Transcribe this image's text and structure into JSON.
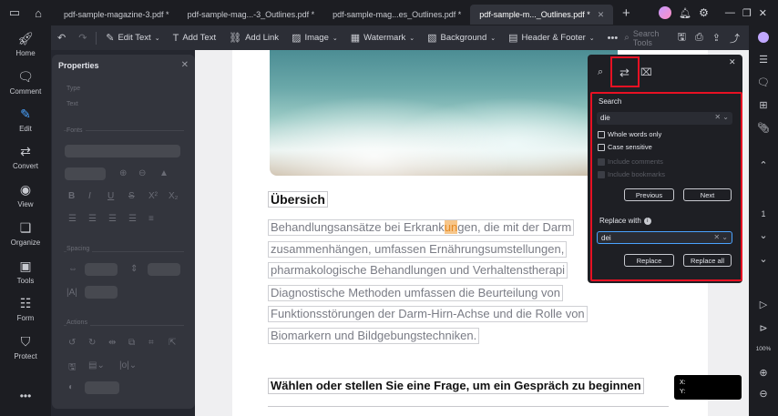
{
  "tabs": [
    {
      "label": "pdf-sample-magazine-3.pdf *",
      "active": false
    },
    {
      "label": "pdf-sample-mag...-3_Outlines.pdf *",
      "active": false
    },
    {
      "label": "pdf-sample-mag...es_Outlines.pdf *",
      "active": false
    },
    {
      "label": "pdf-sample-m..._Outlines.pdf *",
      "active": true
    }
  ],
  "toolbar": {
    "edit_text": "Edit Text",
    "add_text": "Add Text",
    "add_link": "Add Link",
    "image": "Image",
    "watermark": "Watermark",
    "background": "Background",
    "header_footer": "Header & Footer",
    "search_tools": "Search Tools"
  },
  "nav": [
    "Home",
    "Comment",
    "Edit",
    "Convert",
    "View",
    "Organize",
    "Tools",
    "Form",
    "Protect"
  ],
  "properties": {
    "title": "Properties",
    "type": "Type",
    "text": "Text",
    "fonts": "Fonts",
    "spacing": "Spacing",
    "actions": "Actions"
  },
  "document": {
    "heading1": "Übersich",
    "line1_pre": "Behandlungsansätze bei Erkrank",
    "line1_hl": "un",
    "line1_post": "gen, die mit der Darm",
    "line2": "zusammenhängen, umfassen Ernährungsumstellungen,",
    "line3": "pharmakologische Behandlungen und Verhaltenstherapi",
    "line4": "Diagnostische Methoden umfassen die Beurteilung von",
    "line5": "Funktionsstörungen der Darm-Hirn-Achse und die Rolle von",
    "line6": "Biomarkern und Bildgebungstechniken.",
    "heading2": "Wählen oder stellen Sie eine Frage, um ein Gespräch zu beginnen"
  },
  "coords": {
    "x": "X:",
    "y": "Y:"
  },
  "search_panel": {
    "search_label": "Search",
    "search_value": "die",
    "whole_words": "Whole words only",
    "case_sensitive": "Case sensitive",
    "include_comments": "Include comments",
    "include_bookmarks": "Include bookmarks",
    "previous": "Previous",
    "next": "Next",
    "replace_label": "Replace with",
    "replace_value": "dei",
    "replace": "Replace",
    "replace_all": "Replace all"
  },
  "right_strip": {
    "page_number": "1",
    "zoom": "100%"
  },
  "colors": {
    "highlight_box": "#e81123",
    "accent": "#4aa3ff",
    "match_highlight": "#f7c68a"
  }
}
